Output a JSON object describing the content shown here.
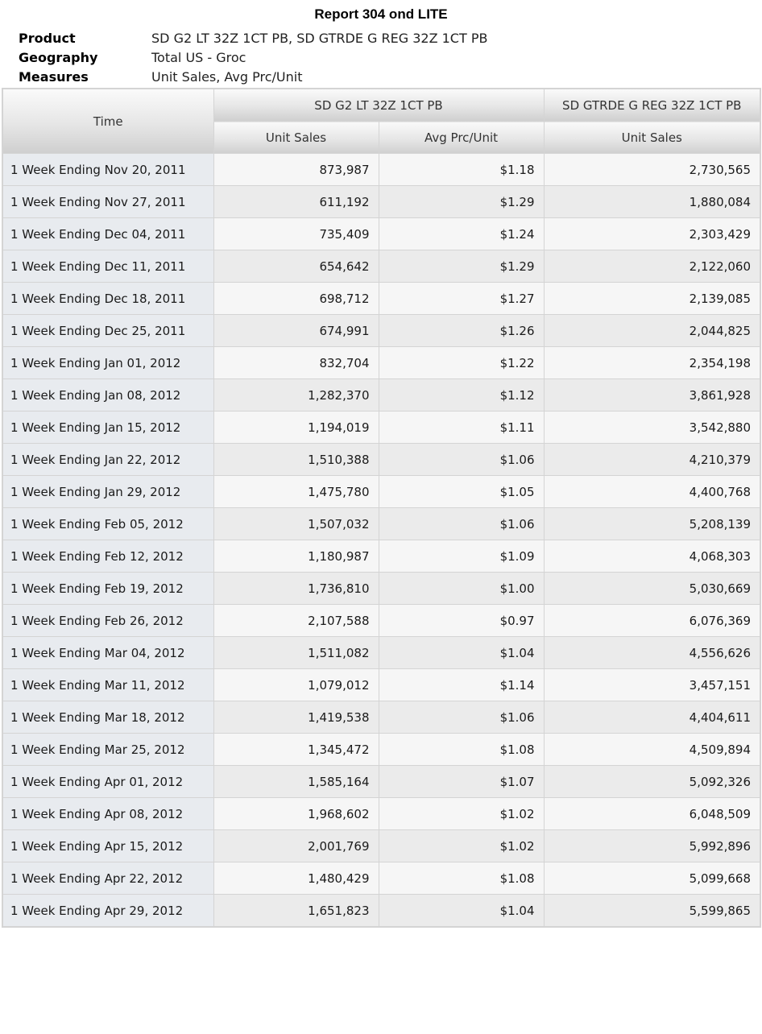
{
  "report": {
    "title": "Report 304 ond LITE"
  },
  "meta": [
    {
      "key": "Product",
      "value": "SD G2 LT 32Z 1CT PB, SD GTRDE G REG 32Z 1CT PB"
    },
    {
      "key": "Geography",
      "value": "Total US - Groc"
    },
    {
      "key": "Measures",
      "value": "Unit Sales, Avg Prc/Unit"
    }
  ],
  "table": {
    "time_header": "Time",
    "groups": [
      {
        "name": "SD G2 LT 32Z 1CT PB",
        "columns": [
          "Unit Sales",
          "Avg Prc/Unit"
        ]
      },
      {
        "name": "SD GTRDE G REG 32Z 1CT PB",
        "columns": [
          "Unit Sales"
        ]
      }
    ],
    "rows": [
      [
        "1 Week Ending Nov 20, 2011",
        "873,987",
        "$1.18",
        "2,730,565"
      ],
      [
        "1 Week Ending Nov 27, 2011",
        "611,192",
        "$1.29",
        "1,880,084"
      ],
      [
        "1 Week Ending Dec 04, 2011",
        "735,409",
        "$1.24",
        "2,303,429"
      ],
      [
        "1 Week Ending Dec 11, 2011",
        "654,642",
        "$1.29",
        "2,122,060"
      ],
      [
        "1 Week Ending Dec 18, 2011",
        "698,712",
        "$1.27",
        "2,139,085"
      ],
      [
        "1 Week Ending Dec 25, 2011",
        "674,991",
        "$1.26",
        "2,044,825"
      ],
      [
        "1 Week Ending Jan 01, 2012",
        "832,704",
        "$1.22",
        "2,354,198"
      ],
      [
        "1 Week Ending Jan 08, 2012",
        "1,282,370",
        "$1.12",
        "3,861,928"
      ],
      [
        "1 Week Ending Jan 15, 2012",
        "1,194,019",
        "$1.11",
        "3,542,880"
      ],
      [
        "1 Week Ending Jan 22, 2012",
        "1,510,388",
        "$1.06",
        "4,210,379"
      ],
      [
        "1 Week Ending Jan 29, 2012",
        "1,475,780",
        "$1.05",
        "4,400,768"
      ],
      [
        "1 Week Ending Feb 05, 2012",
        "1,507,032",
        "$1.06",
        "5,208,139"
      ],
      [
        "1 Week Ending Feb 12, 2012",
        "1,180,987",
        "$1.09",
        "4,068,303"
      ],
      [
        "1 Week Ending Feb 19, 2012",
        "1,736,810",
        "$1.00",
        "5,030,669"
      ],
      [
        "1 Week Ending Feb 26, 2012",
        "2,107,588",
        "$0.97",
        "6,076,369"
      ],
      [
        "1 Week Ending Mar 04, 2012",
        "1,511,082",
        "$1.04",
        "4,556,626"
      ],
      [
        "1 Week Ending Mar 11, 2012",
        "1,079,012",
        "$1.14",
        "3,457,151"
      ],
      [
        "1 Week Ending Mar 18, 2012",
        "1,419,538",
        "$1.06",
        "4,404,611"
      ],
      [
        "1 Week Ending Mar 25, 2012",
        "1,345,472",
        "$1.08",
        "4,509,894"
      ],
      [
        "1 Week Ending Apr 01, 2012",
        "1,585,164",
        "$1.07",
        "5,092,326"
      ],
      [
        "1 Week Ending Apr 08, 2012",
        "1,968,602",
        "$1.02",
        "6,048,509"
      ],
      [
        "1 Week Ending Apr 15, 2012",
        "2,001,769",
        "$1.02",
        "5,992,896"
      ],
      [
        "1 Week Ending Apr 22, 2012",
        "1,480,429",
        "$1.08",
        "5,099,668"
      ],
      [
        "1 Week Ending Apr 29, 2012",
        "1,651,823",
        "$1.04",
        "5,599,865"
      ]
    ]
  }
}
